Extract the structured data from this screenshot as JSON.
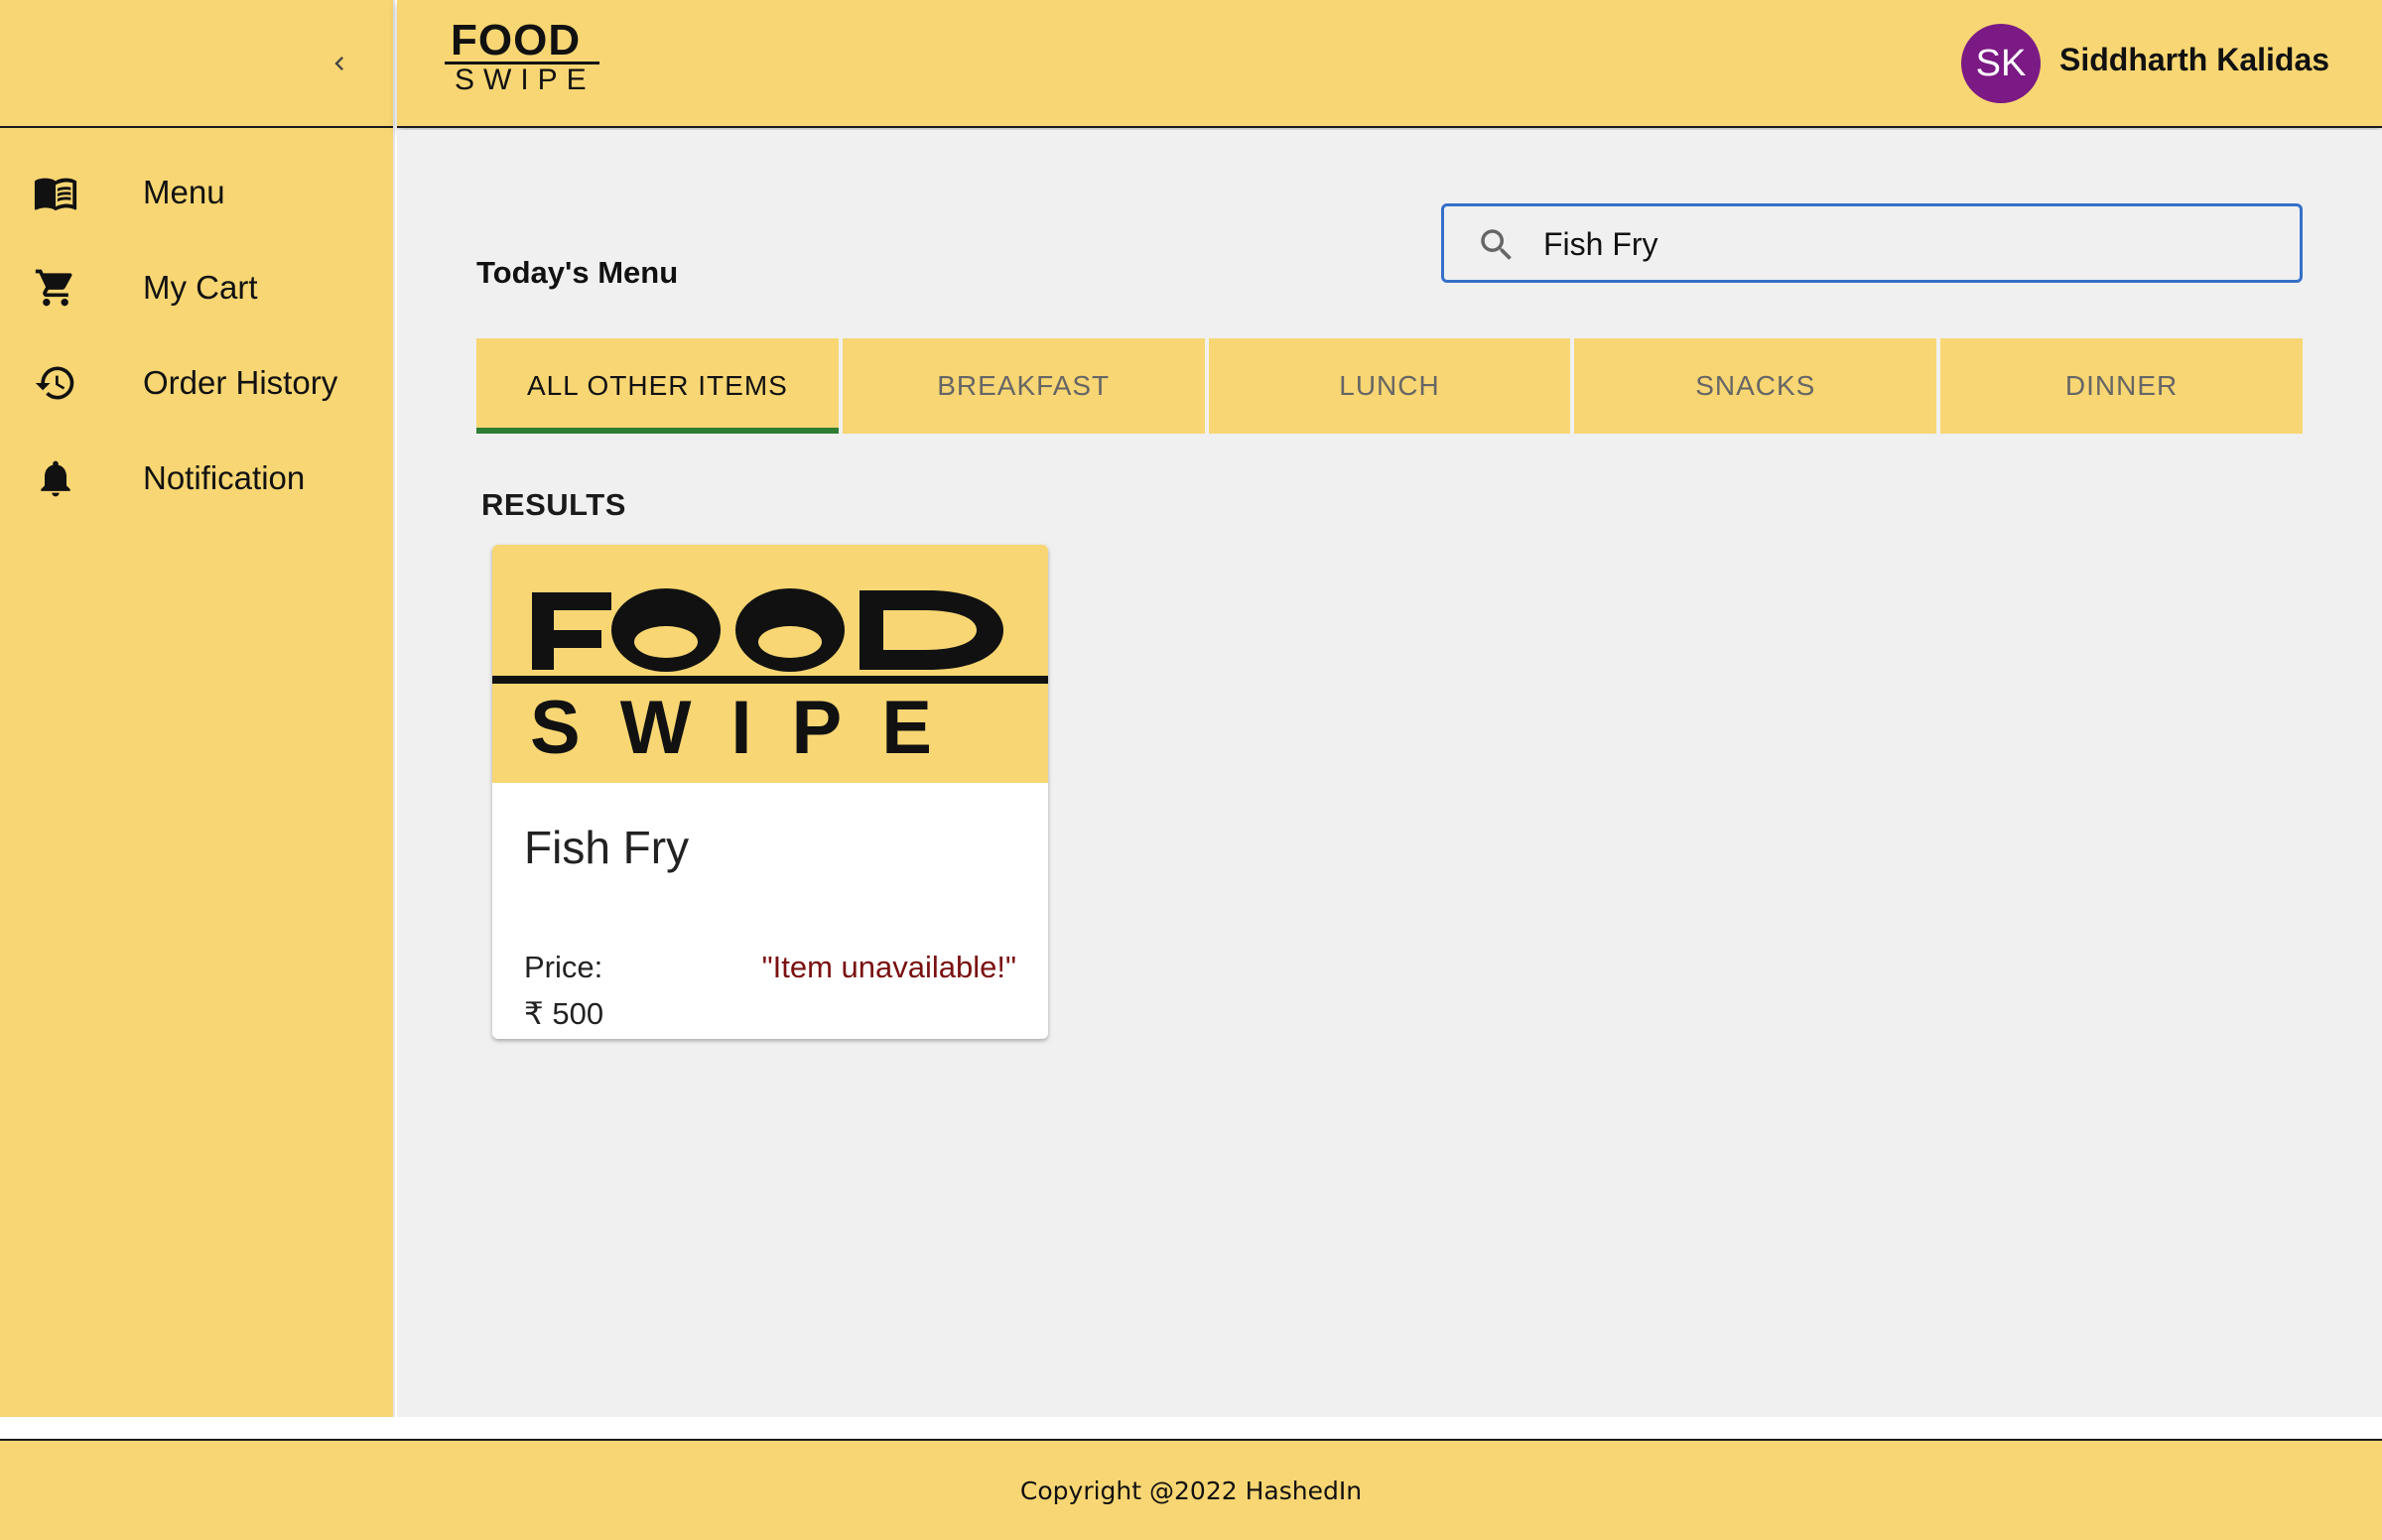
{
  "app": {
    "logo_text_top": "FOOD",
    "logo_text_bottom": "SWIPE",
    "brand_color": "#f8d673",
    "accent_color": "#2e7d32"
  },
  "sidebar": {
    "collapse_icon": "chevron-left-icon",
    "items": [
      {
        "label": "Menu",
        "icon": "menu-book-icon"
      },
      {
        "label": "My Cart",
        "icon": "shopping-cart-icon"
      },
      {
        "label": "Order History",
        "icon": "history-icon"
      },
      {
        "label": "Notification",
        "icon": "bell-icon"
      }
    ]
  },
  "header": {
    "avatar_initials": "SK",
    "avatar_color": "#7b1a84",
    "user_name": "Siddharth Kalidas"
  },
  "main": {
    "title": "Today's Menu",
    "search": {
      "value": "Fish Fry",
      "placeholder": "",
      "icon": "search-icon"
    },
    "tabs": [
      {
        "label": "ALL OTHER ITEMS",
        "active": true
      },
      {
        "label": "BREAKFAST",
        "active": false
      },
      {
        "label": "LUNCH",
        "active": false
      },
      {
        "label": "SNACKS",
        "active": false
      },
      {
        "label": "DINNER",
        "active": false
      }
    ],
    "results_title": "RESULTS",
    "results": [
      {
        "name": "Fish Fry",
        "price_label": "Price:",
        "price": "₹ 500",
        "status": "\"Item unavailable!\"",
        "status_color": "#7a1010"
      }
    ]
  },
  "footer": {
    "copyright": "Copyright @2022 HashedIn"
  }
}
